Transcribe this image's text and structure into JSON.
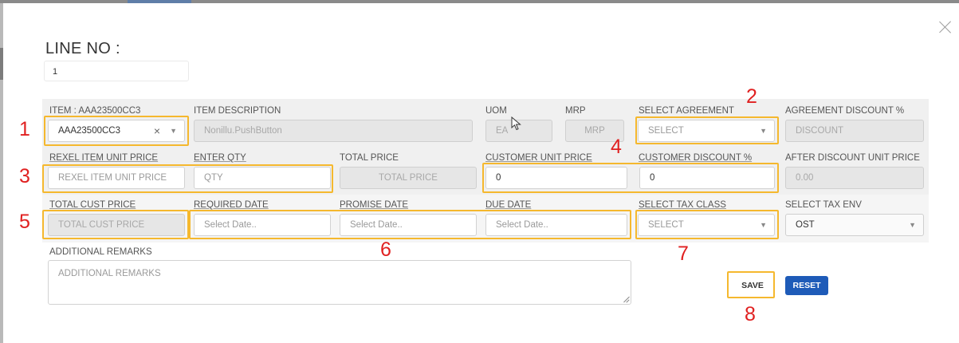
{
  "colors": {
    "highlight": "#f5b82e",
    "annotation": "#e02020",
    "reset_button": "#1e5bb8",
    "band": "#f0f0f0"
  },
  "icons": {
    "close": "close-icon",
    "dropdown": "chevron-down-icon",
    "clear": "clear-icon",
    "cursor": "mouse-pointer-icon",
    "resize": "resize-handle-icon"
  },
  "line_no": {
    "label": "LINE NO :",
    "value": "1"
  },
  "row1": {
    "item": {
      "label": "ITEM : AAA23500CC3",
      "value": "AAA23500CC3",
      "clear": "×"
    },
    "item_description": {
      "label": "ITEM DESCRIPTION",
      "value": "Nonillu.PushButton"
    },
    "uom": {
      "label": "UOM",
      "value": "EA"
    },
    "mrp": {
      "label": "MRP",
      "placeholder": "MRP"
    },
    "select_agreement": {
      "label": "SELECT AGREEMENT",
      "value": "SELECT"
    },
    "agreement_discount": {
      "label": "AGREEMENT DISCOUNT %",
      "placeholder": "DISCOUNT"
    }
  },
  "row2": {
    "rexel_item_unit_price": {
      "label": "REXEL ITEM UNIT PRICE",
      "placeholder": "REXEL ITEM UNIT PRICE"
    },
    "enter_qty": {
      "label": "ENTER QTY",
      "placeholder": "QTY"
    },
    "total_price": {
      "label": "TOTAL PRICE",
      "placeholder": "TOTAL PRICE"
    },
    "customer_unit_price": {
      "label": "CUSTOMER UNIT PRICE",
      "value": "0"
    },
    "customer_discount": {
      "label": "CUSTOMER DISCOUNT %",
      "value": "0"
    },
    "after_discount_unit_price": {
      "label": "AFTER DISCOUNT UNIT PRICE",
      "value": "0.00"
    }
  },
  "row3": {
    "total_cust_price": {
      "label": "TOTAL CUST PRICE",
      "placeholder": "TOTAL CUST PRICE"
    },
    "required_date": {
      "label": "REQUIRED DATE",
      "placeholder": "Select Date.."
    },
    "promise_date": {
      "label": "PROMISE DATE",
      "placeholder": "Select Date.."
    },
    "due_date": {
      "label": "DUE DATE",
      "placeholder": "Select Date.."
    },
    "select_tax_class": {
      "label": "SELECT TAX CLASS",
      "value": "SELECT"
    },
    "select_tax_env": {
      "label": "SELECT TAX ENV",
      "value": "OST"
    }
  },
  "remarks": {
    "label": "ADDITIONAL REMARKS",
    "placeholder": "ADDITIONAL REMARKS"
  },
  "buttons": {
    "save": "SAVE",
    "reset": "RESET"
  },
  "annotations": [
    "1",
    "2",
    "3",
    "4",
    "5",
    "6",
    "7",
    "8"
  ]
}
